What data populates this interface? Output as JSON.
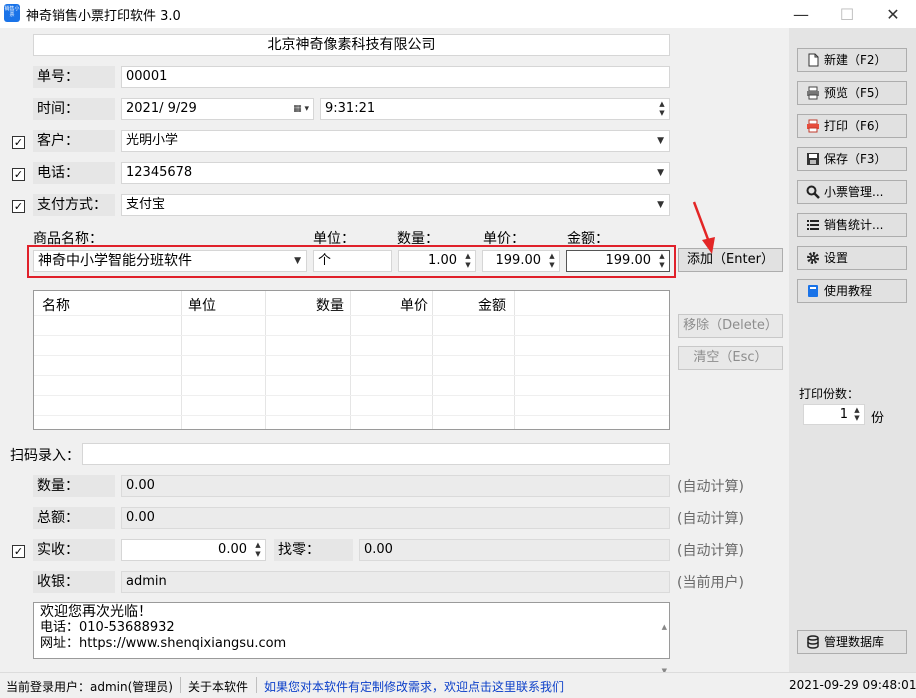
{
  "window": {
    "title": "神奇销售小票打印软件 3.0",
    "icon_text": "销售小票",
    "minimize": "—",
    "maximize": "☐",
    "close": "✕"
  },
  "form": {
    "shop_name": "北京神奇像素科技有限公司",
    "order_no": {
      "label": "单号：",
      "value": "00001"
    },
    "time": {
      "label": "时间：",
      "date": "2021/  9/29",
      "time": "9:31:21"
    },
    "customer": {
      "label": "客户：",
      "value": "光明小学",
      "checked": true
    },
    "phone": {
      "label": "电话：",
      "value": "12345678",
      "checked": true
    },
    "payment": {
      "label": "支付方式：",
      "value": "支付宝",
      "checked": true
    }
  },
  "item_entry": {
    "headers": {
      "name": "商品名称：",
      "unit": "单位：",
      "qty": "数量：",
      "price": "单价：",
      "amount": "金额："
    },
    "name": "神奇中小学智能分班软件",
    "unit": "个",
    "qty": "1.00",
    "price": "199.00",
    "amount": "199.00",
    "add_button": "添加（Enter）"
  },
  "table": {
    "columns": [
      "名称",
      "单位",
      "数量",
      "单价",
      "金额"
    ],
    "rows": [],
    "remove_button": "移除（Delete）",
    "clear_button": "清空（Esc）"
  },
  "scan": {
    "label": "扫码录入：",
    "value": ""
  },
  "summary": {
    "qty": {
      "label": "数量：",
      "value": "0.00"
    },
    "total": {
      "label": "总额：",
      "value": "0.00"
    },
    "received": {
      "label": "实收：",
      "value": "0.00",
      "checked": true
    },
    "change": {
      "label": "找零：",
      "value": "0.00"
    },
    "cashier": {
      "label": "收银：",
      "value": "admin"
    },
    "auto_calc": "(自动计算)",
    "current_user": "(当前用户)"
  },
  "footer_note": [
    "欢迎您再次光临！",
    "电话：010-53688932",
    "网址：https://www.shenqixiangsu.com"
  ],
  "sidebar": {
    "buttons": [
      {
        "label": "新建（F2）",
        "icon": "new-file-icon"
      },
      {
        "label": "预览（F5）",
        "icon": "printer-preview-icon"
      },
      {
        "label": "打印（F6）",
        "icon": "printer-icon"
      },
      {
        "label": "保存（F3）",
        "icon": "save-icon"
      },
      {
        "label": "小票管理...",
        "icon": "search-icon"
      },
      {
        "label": "销售统计...",
        "icon": "list-icon"
      },
      {
        "label": "设置",
        "icon": "gear-icon"
      },
      {
        "label": "使用教程",
        "icon": "book-icon"
      }
    ],
    "copies_label": "打印份数：",
    "copies_value": "1",
    "copies_unit": "份",
    "db_button": "管理数据库"
  },
  "statusbar": {
    "user": "当前登录用户：admin(管理员)",
    "about": "关于本软件",
    "custom_link": "如果您对本软件有定制修改需求，欢迎点击这里联系我们",
    "datetime": "2021-09-29 09:48:01"
  },
  "colors": {
    "highlight_border": "#e0202a",
    "link": "#0b3fc9",
    "arrow": "#e32626",
    "accent_icon": "#1a73e8"
  }
}
